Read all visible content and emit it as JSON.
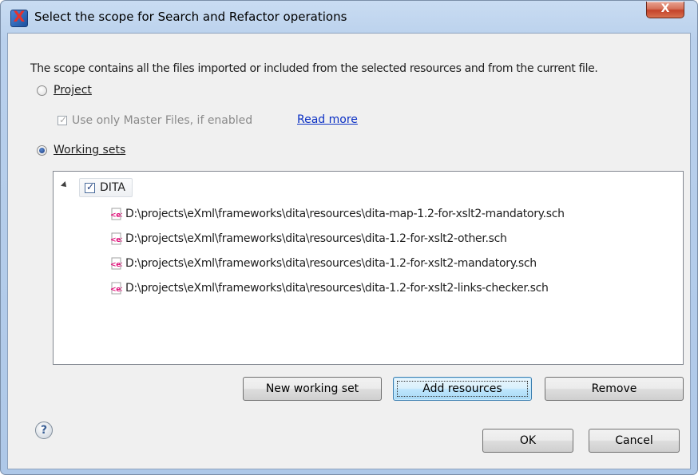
{
  "window": {
    "title": "Select the scope for Search and Refactor operations",
    "close_glyph": "X",
    "app_icon_glyph": "X"
  },
  "description": "The scope contains all the files imported or included from the selected resources and from the current file.",
  "options": {
    "project": {
      "label": "Project",
      "selected": false
    },
    "master_files": {
      "label": "Use only Master Files, if enabled",
      "checked": true,
      "enabled": false
    },
    "read_more": "Read more",
    "working_sets": {
      "label": "Working sets",
      "selected": true
    }
  },
  "tree": {
    "root": {
      "label": "DITA",
      "checked": true,
      "expanded": true
    },
    "files": [
      "D:\\projects\\eXml\\frameworks\\dita\\resources\\dita-map-1.2-for-xslt2-mandatory.sch",
      "D:\\projects\\eXml\\frameworks\\dita\\resources\\dita-1.2-for-xslt2-other.sch",
      "D:\\projects\\eXml\\frameworks\\dita\\resources\\dita-1.2-for-xslt2-mandatory.sch",
      "D:\\projects\\eXml\\frameworks\\dita\\resources\\dita-1.2-for-xslt2-links-checker.sch"
    ]
  },
  "buttons": {
    "new_working_set": "New working set",
    "add_resources": "Add resources",
    "remove": "Remove",
    "ok": "OK",
    "cancel": "Cancel",
    "help": "?"
  },
  "icons": {
    "app": "app-logo-icon",
    "file": "schematron-file-icon",
    "help": "help-icon",
    "expand": "expand-arrow-icon"
  },
  "colors": {
    "link": "#0b30c4",
    "file_icon": "#e0117a",
    "dialog_bg": "#f0f0f0"
  }
}
